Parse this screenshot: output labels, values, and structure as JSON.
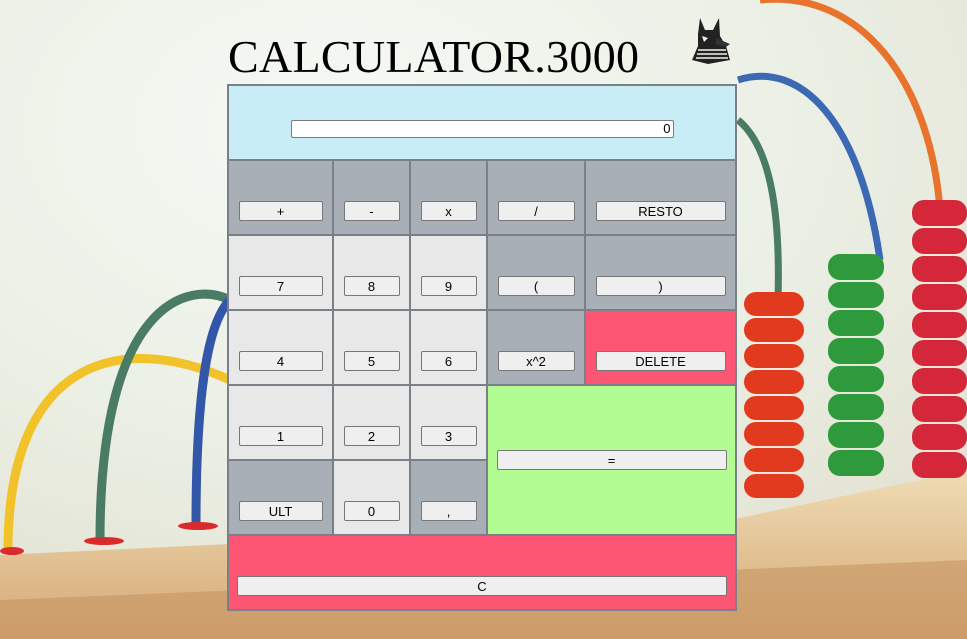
{
  "title": "CALCULATOR.3000",
  "display": {
    "value": "0"
  },
  "buttons": {
    "plus": "+",
    "minus": "-",
    "times": "x",
    "divide": "/",
    "resto": "RESTO",
    "seven": "7",
    "eight": "8",
    "nine": "9",
    "open_paren": "(",
    "close_paren": ")",
    "four": "4",
    "five": "5",
    "six": "6",
    "square": "x^2",
    "delete": "DELETE",
    "one": "1",
    "two": "2",
    "three": "3",
    "equals": "=",
    "ult": "ULT",
    "zero": "0",
    "comma": ",",
    "clear": "C"
  },
  "colors": {
    "display_bg": "#c9edf6",
    "operator_bg": "#a8afb6",
    "number_bg": "#e8e8e8",
    "delete_bg": "#fd5574",
    "equals_bg": "#b2fc93",
    "clear_bg": "#fd5574"
  },
  "icons": {
    "logo": "anubis-head-icon"
  }
}
